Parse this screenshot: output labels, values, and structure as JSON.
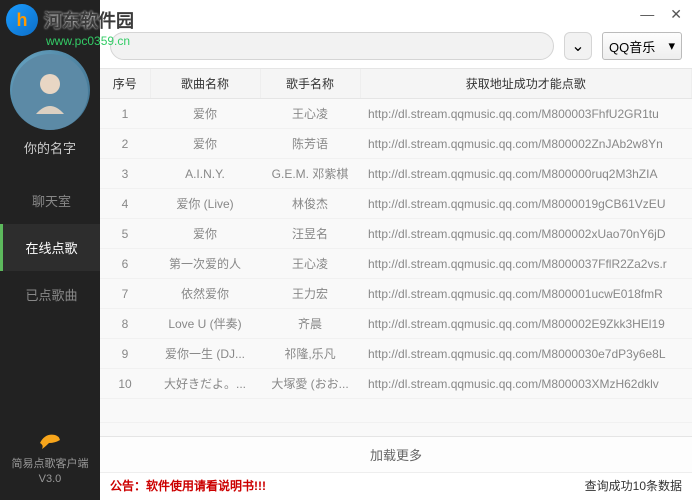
{
  "brand": {
    "title": "河东软件园",
    "sub": "www.pc0359.cn"
  },
  "sidebar": {
    "username": "你的名字",
    "menu": [
      "聊天室",
      "在线点歌",
      "已点歌曲"
    ],
    "active_index": 1,
    "bottom_title": "简易点歌客户端",
    "bottom_version": "V3.0"
  },
  "titlebar": {
    "min": "—",
    "close": "✕"
  },
  "search": {
    "placeholder": "",
    "dropdown_glyph": "⌄",
    "source": "QQ音乐",
    "source_arrow": "▾"
  },
  "table": {
    "headers": {
      "idx": "序号",
      "song": "歌曲名称",
      "artist": "歌手名称",
      "url": "获取地址成功才能点歌"
    },
    "rows": [
      {
        "idx": "1",
        "song": "爱你",
        "artist": "王心凌",
        "url": "http://dl.stream.qqmusic.qq.com/M800003FhfU2GR1tu"
      },
      {
        "idx": "2",
        "song": "爱你",
        "artist": "陈芳语",
        "url": "http://dl.stream.qqmusic.qq.com/M800002ZnJAb2w8Yn"
      },
      {
        "idx": "3",
        "song": "A.I.N.Y.",
        "artist": "G.E.M. 邓紫棋",
        "url": "http://dl.stream.qqmusic.qq.com/M800000ruq2M3hZIA"
      },
      {
        "idx": "4",
        "song": "爱你 (Live)",
        "artist": "林俊杰",
        "url": "http://dl.stream.qqmusic.qq.com/M8000019gCB61VzEU"
      },
      {
        "idx": "5",
        "song": "爱你",
        "artist": "汪昱名",
        "url": "http://dl.stream.qqmusic.qq.com/M800002xUao70nY6jD"
      },
      {
        "idx": "6",
        "song": "第一次爱的人",
        "artist": "王心凌",
        "url": "http://dl.stream.qqmusic.qq.com/M8000037FflR2Za2vs.r"
      },
      {
        "idx": "7",
        "song": "依然爱你",
        "artist": "王力宏",
        "url": "http://dl.stream.qqmusic.qq.com/M800001ucwE018fmR"
      },
      {
        "idx": "8",
        "song": "Love U (伴奏)",
        "artist": "齐晨",
        "url": "http://dl.stream.qqmusic.qq.com/M800002E9Zkk3HEl19"
      },
      {
        "idx": "9",
        "song": "爱你一生 (DJ...",
        "artist": "祁隆,乐凡",
        "url": "http://dl.stream.qqmusic.qq.com/M8000030e7dP3y6e8L"
      },
      {
        "idx": "10",
        "song": "大好きだよ。...",
        "artist": "大塚愛 (おお...",
        "url": "http://dl.stream.qqmusic.qq.com/M800003XMzH62dklv"
      }
    ],
    "load_more": "加载更多"
  },
  "footer": {
    "notice": "公告：软件使用请看说明书!!!",
    "status": "查询成功10条数据"
  }
}
